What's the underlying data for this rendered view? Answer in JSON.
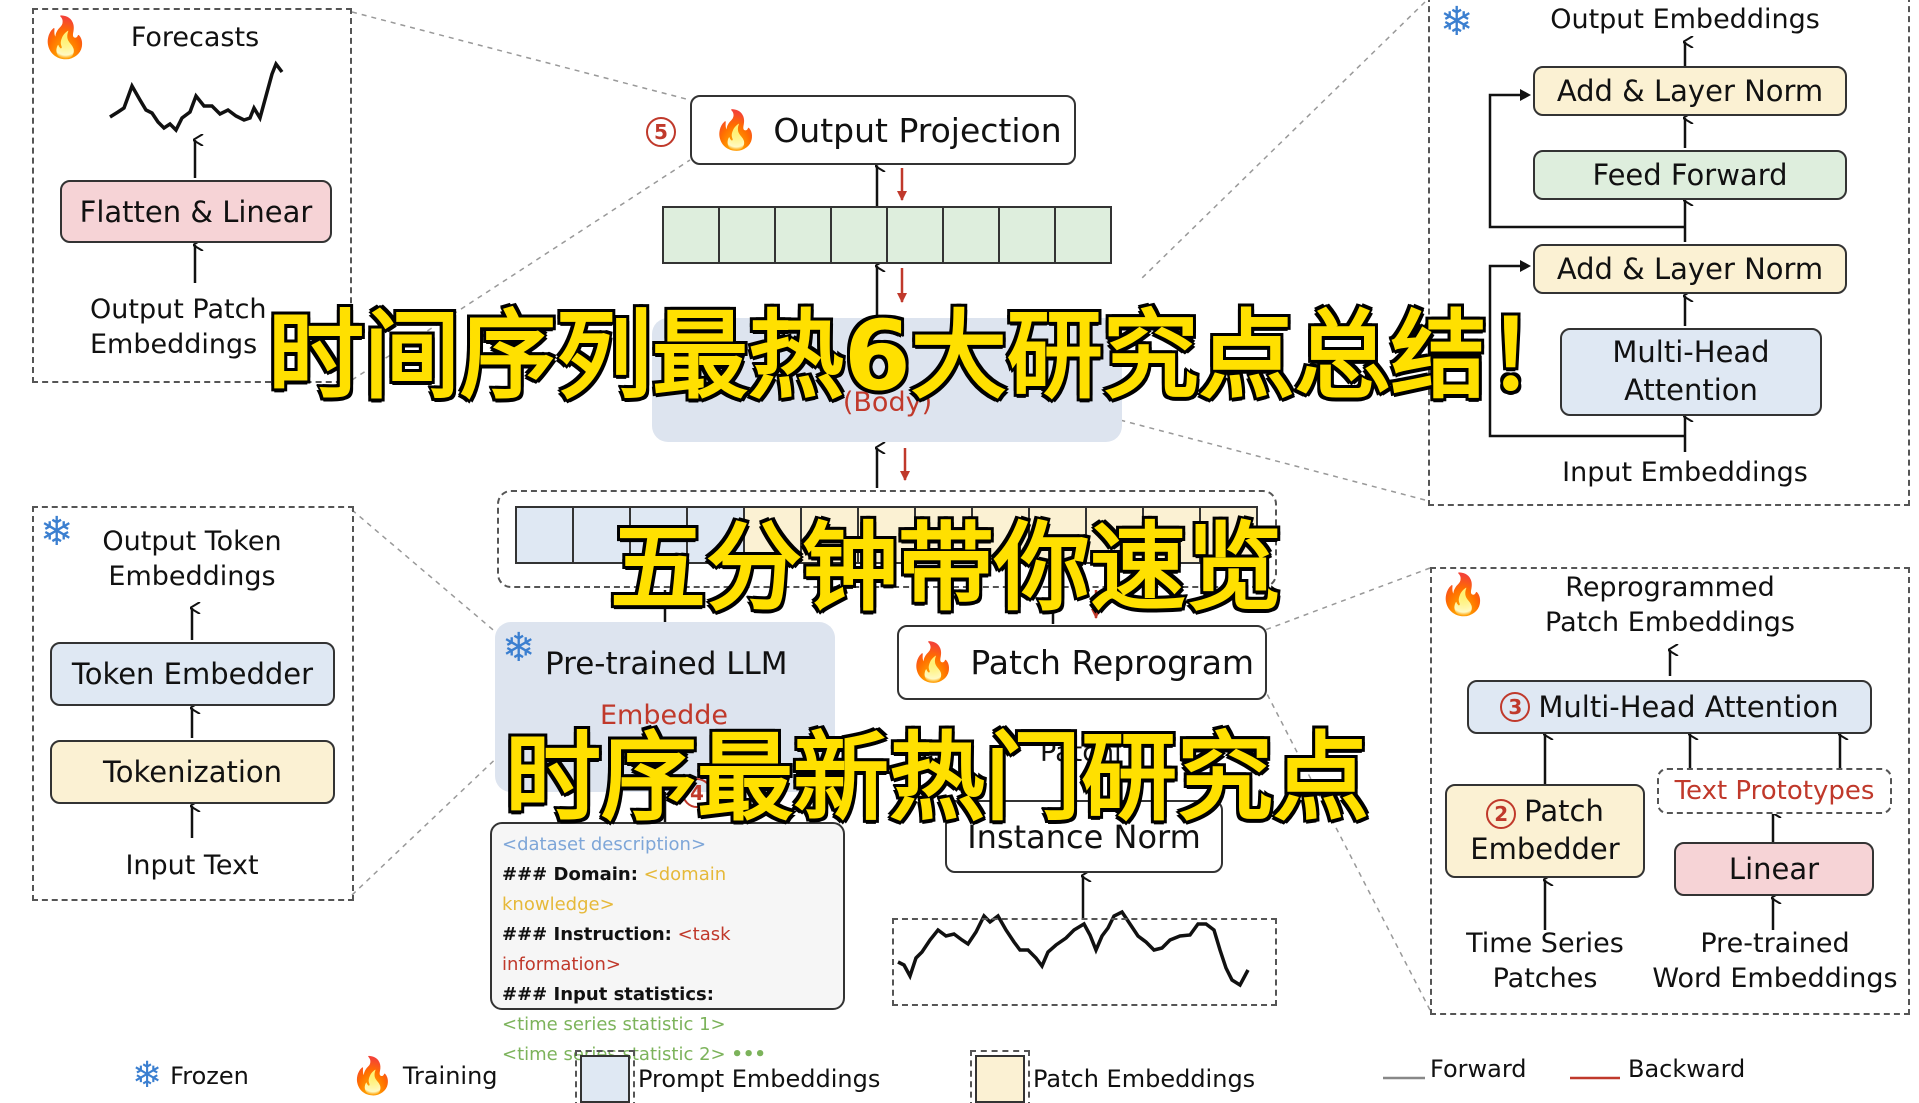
{
  "overlay": {
    "line1": "时间序列最热6大研究点总结！",
    "line2": "五分钟带你速览",
    "line3": "时序最新热门研究点"
  },
  "icons": {
    "training": "fire-icon",
    "frozen": "snowflake-icon",
    "training_glyph": "🔥",
    "frozen_glyph": "❄"
  },
  "output_head_panel": {
    "title": "Forecasts",
    "block": "Flatten & Linear",
    "input_label_line1": "Output Patch",
    "input_label_line2": "Embeddings"
  },
  "token_panel": {
    "output_line1": "Output Token",
    "output_line2": "Embeddings",
    "block_top": "Token Embedder",
    "block_bottom": "Tokenization",
    "input": "Input Text"
  },
  "transformer_panel": {
    "output": "Output Embeddings",
    "add_norm_top": "Add & Layer Norm",
    "feed_forward": "Feed Forward",
    "add_norm_bottom": "Add & Layer Norm",
    "attention_line1": "Multi-Head",
    "attention_line2": "Attention",
    "input": "Input Embeddings"
  },
  "reprogram_panel": {
    "output_line1": "Reprogrammed",
    "output_line2": "Patch Embeddings",
    "attention": "Multi-Head Attention",
    "attention_step": "3",
    "text_prototypes": "Text Prototypes",
    "patch_embedder_line1": "Patch",
    "patch_embedder_line2": "Embedder",
    "patch_embedder_step": "2",
    "linear": "Linear",
    "ts_line1": "Time Series",
    "ts_line2": "Patches",
    "word_line1": "Pre-trained",
    "word_line2": "Word Embeddings"
  },
  "center": {
    "output_projection": "Output Projection",
    "output_projection_step": "5",
    "body_label": "(Body)",
    "pretrained_llm": "Pre-trained LLM",
    "patch_reprogram": "Patch Reprogram",
    "patching_partial": "Patchi",
    "instance_norm": "Instance Norm",
    "embedder_partial": "Embedde",
    "prompt_step": "4"
  },
  "prompt": {
    "line1": "<dataset description>",
    "domain_key": "### Domain:",
    "domain_val": "<domain knowledge>",
    "instr_key": "### Instruction:",
    "instr_val": "<task information>",
    "stats_key": "### Input statistics:",
    "stat1": "<time series statistic 1>",
    "stat2": "<time series statistic 2>",
    "ellipsis": "•••"
  },
  "legend": {
    "frozen": "Frozen",
    "training": "Training",
    "prompt_embeddings": "Prompt Embeddings",
    "patch_embeddings": "Patch Embeddings",
    "forward": "Forward",
    "backward": "Backward"
  },
  "colors": {
    "overlay_yellow": "#ffe000",
    "step_red": "#c0392b",
    "prompt_blue": "#dfe8f3",
    "patch_yellow": "#fbf1d3"
  }
}
